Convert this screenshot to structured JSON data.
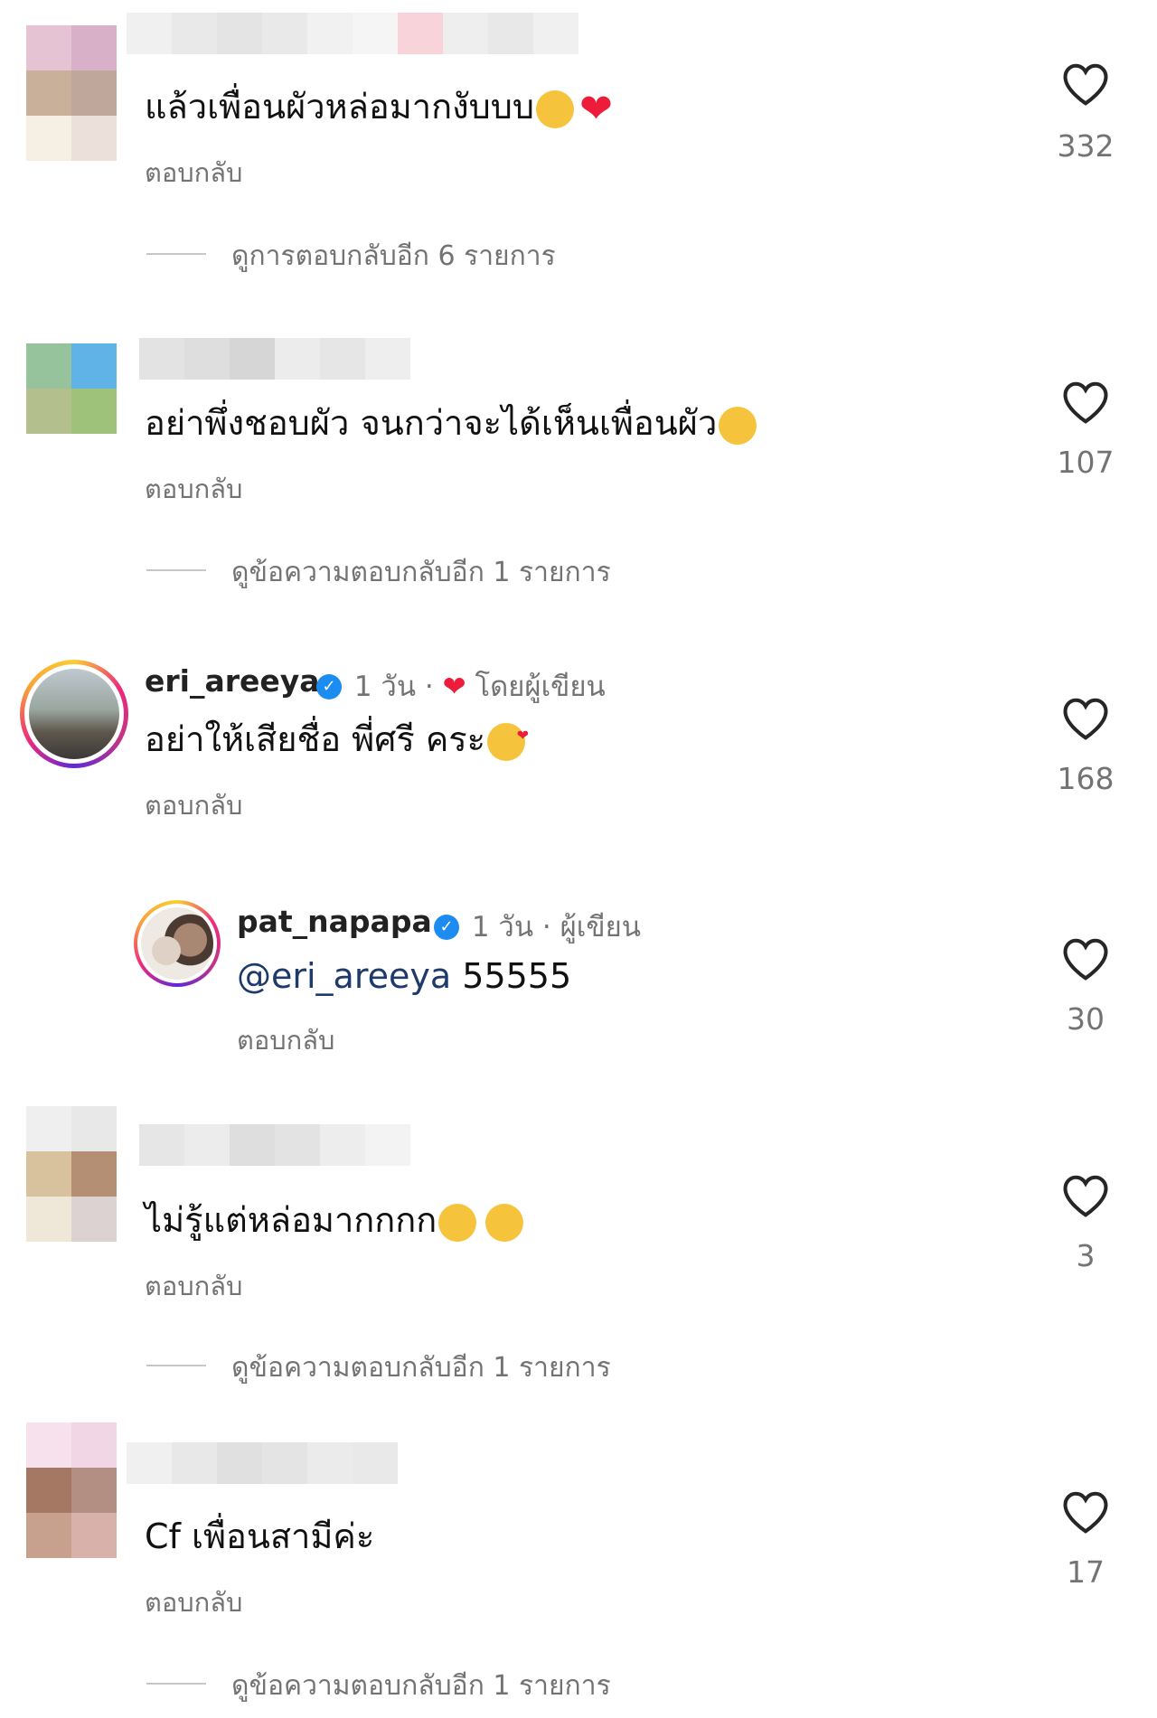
{
  "comments": [
    {
      "text": "แล้วเพื่อนผัวหล่อมากงับบบ",
      "emojis": [
        "tears-of-joy",
        "red-heart"
      ],
      "reply": "ตอบกลับ",
      "likes": "332",
      "view_replies": "ดูการตอบกลับอีก 6 รายการ"
    },
    {
      "text": "อย่าพึ่งชอบผัว จนกว่าจะได้เห็นเพื่อนผัว",
      "emojis": [
        "rolling-on-floor-laughing"
      ],
      "reply": "ตอบกลับ",
      "likes": "107",
      "view_replies": "ดูข้อความตอบกลับอีก 1 รายการ"
    },
    {
      "username": "eri_areeya",
      "time": "1 วัน",
      "author_tag": "โดยผู้เขียน",
      "text": "อย่าให้เสียชื่อ พี่ศรี คระ",
      "emojis": [
        "face-blowing-kiss"
      ],
      "reply": "ตอบกลับ",
      "likes": "168"
    },
    {
      "username": "pat_napapa",
      "time": "1 วัน",
      "author_tag": "ผู้เขียน",
      "mention": "@eri_areeya",
      "text": "55555",
      "reply": "ตอบกลับ",
      "likes": "30"
    },
    {
      "text": "ไม่รู้แต่หล่อมากกกก",
      "emojis": [
        "tears-of-joy",
        "tears-of-joy"
      ],
      "reply": "ตอบกลับ",
      "likes": "3",
      "view_replies": "ดูข้อความตอบกลับอีก 1 รายการ"
    },
    {
      "text": "Cf เพื่อนสามีค่ะ",
      "reply": "ตอบกลับ",
      "likes": "17",
      "view_replies": "ดูข้อความตอบกลับอีก 1 รายการ"
    }
  ],
  "colors": {
    "secondary_text": "#737373",
    "mention": "#1e3a6b",
    "verified": "#1d8cf0",
    "heart_red": "#ed1c3a"
  }
}
